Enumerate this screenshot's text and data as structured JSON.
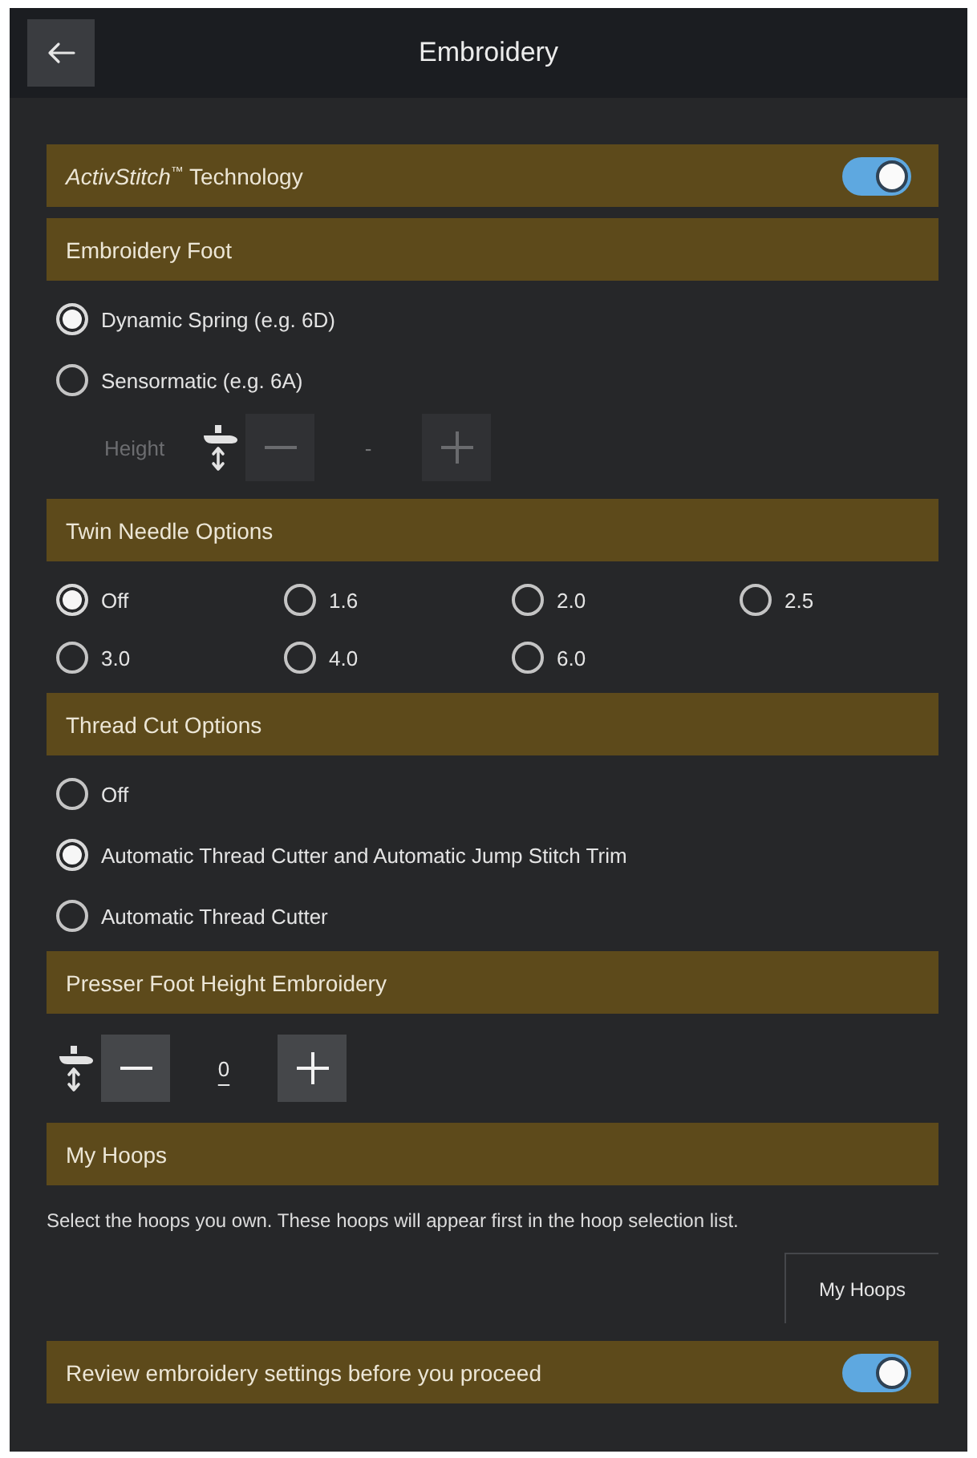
{
  "header": {
    "title": "Embroidery"
  },
  "sections": [
    {
      "kind": "toggle",
      "title": "*ActivStitch*$^{™}$ Technology",
      "on": true
    },
    {
      "kind": "radio-list",
      "title": "Embroidery Foot",
      "options": [
        {
          "label": "Dynamic Spring (e.g. 6D)",
          "selected": true
        },
        {
          "label": "Sensormatic (e.g. 6A)",
          "selected": false
        }
      ],
      "stepper": {
        "label": "Height",
        "value": "-",
        "disabled": true
      }
    },
    {
      "kind": "radio-grid",
      "title": "Twin Needle Options",
      "options": [
        {
          "label": "Off",
          "selected": true
        },
        {
          "label": "1.6",
          "selected": false
        },
        {
          "label": "2.0",
          "selected": false
        },
        {
          "label": "2.5",
          "selected": false
        },
        {
          "label": "3.0",
          "selected": false
        },
        {
          "label": "4.0",
          "selected": false
        },
        {
          "label": "6.0",
          "selected": false
        }
      ]
    },
    {
      "kind": "radio-list",
      "title": "Thread Cut Options",
      "options": [
        {
          "label": "Off",
          "selected": false
        },
        {
          "label": "Automatic Thread Cutter and Automatic Jump Stitch Trim",
          "selected": true
        },
        {
          "label": "Automatic Thread Cutter",
          "selected": false
        }
      ]
    },
    {
      "kind": "stepper",
      "title": "Presser Foot Height Embroidery",
      "stepper": {
        "value": "0",
        "disabled": false
      }
    },
    {
      "kind": "hoops",
      "title": "My Hoops",
      "description": "Select the hoops you own. These hoops will appear first in the hoop selection list.",
      "button": "My Hoops"
    },
    {
      "kind": "toggle",
      "title": "Review embroidery settings before you proceed",
      "on": true
    }
  ]
}
